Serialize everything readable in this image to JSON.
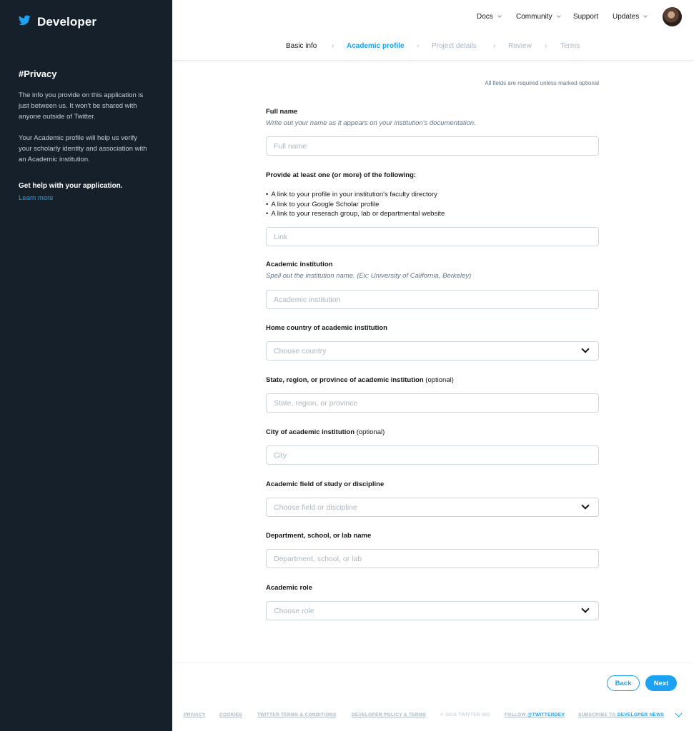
{
  "sidebar": {
    "brand": "Developer",
    "privacy_heading": "#Privacy",
    "privacy_text_1": "The info you provide on this application is just between us. It won't be shared with anyone outside of Twitter.",
    "privacy_text_2": "Your Academic profile will help us verify your scholarly identity and association with an Academic institution.",
    "help_heading": "Get help with your application.",
    "learn_more": "Learn more"
  },
  "nav": {
    "docs": "Docs",
    "community": "Community",
    "support": "Support",
    "updates": "Updates"
  },
  "steps": [
    {
      "label": "Basic info",
      "state": "done"
    },
    {
      "label": "Academic profile",
      "state": "active"
    },
    {
      "label": "Project details",
      "state": "upcoming"
    },
    {
      "label": "Review",
      "state": "upcoming"
    },
    {
      "label": "Terms",
      "state": "upcoming"
    }
  ],
  "form": {
    "required_note": "All fields are required unless marked optional",
    "full_name": {
      "label": "Full name",
      "hint": "Write out your name as it appears on your institution's documentation.",
      "placeholder": "Full name",
      "value": ""
    },
    "links": {
      "label": "Provide at least one (or more) of the following:",
      "bullets": [
        "A link to your profile in your institution's faculty directory",
        "A link to your Google Scholar profile",
        "A link to your reserach group, lab or departmental website"
      ],
      "placeholder": "Link",
      "value": ""
    },
    "institution": {
      "label": "Academic institution",
      "hint": "Spell out the institution name. (Ex: University of California, Berkeley)",
      "placeholder": "Academic institution",
      "value": ""
    },
    "country": {
      "label": "Home country of academic institution",
      "placeholder": "Choose country"
    },
    "state": {
      "label": "State, region, or province of academic institution",
      "optional": "(optional)",
      "placeholder": "State, region, or province",
      "value": ""
    },
    "city": {
      "label": "City of academic institution",
      "optional": "(optional)",
      "placeholder": "City",
      "value": ""
    },
    "field": {
      "label": "Academic field of study or discipline",
      "placeholder": "Choose field or discipline"
    },
    "department": {
      "label": "Department, school, or lab name",
      "placeholder": "Department, school, or lab",
      "value": ""
    },
    "role": {
      "label": "Academic role",
      "placeholder": "Choose role"
    }
  },
  "actions": {
    "back": "Back",
    "next": "Next"
  },
  "footer": {
    "privacy": "PRIVACY",
    "cookies": "COOKIES",
    "terms": "TWITTER TERMS & CONDITIONS",
    "policy": "DEVELOPER POLICY & TERMS",
    "copyright": "© 2019 TWITTER INC",
    "follow_prefix": "FOLLOW",
    "follow_handle": "@TWITTERDEV",
    "subscribe_prefix": "SUBSCRIBE TO",
    "subscribe_target": "DEVELOPER NEWS"
  },
  "colors": {
    "sidebar_bg": "#15202b",
    "accent": "#1da1f2",
    "border": "#ccd6dd",
    "muted": "#aab8c2"
  },
  "icons": {
    "brand": "twitter-bird-icon",
    "dropdown": "chevron-down-icon"
  }
}
